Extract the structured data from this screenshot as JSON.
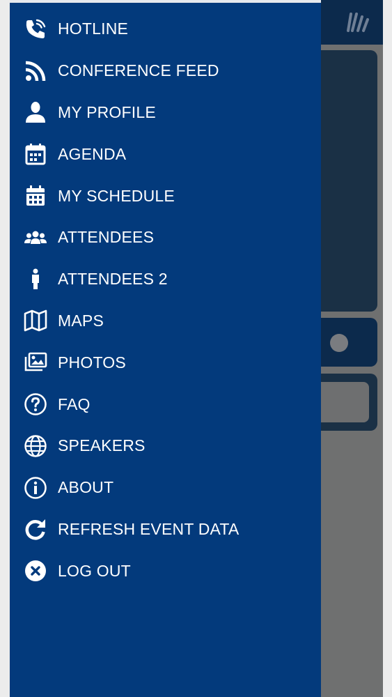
{
  "colors": {
    "drawer_bg": "#033a7c",
    "overlay_bg": "#6f7070",
    "app_header_bg": "#0c2a4c",
    "text": "#ffffff"
  },
  "menu": {
    "items": [
      {
        "label": "HOTLINE",
        "icon": "phone-icon"
      },
      {
        "label": "CONFERENCE FEED",
        "icon": "rss-icon"
      },
      {
        "label": "MY PROFILE",
        "icon": "user-icon"
      },
      {
        "label": "AGENDA",
        "icon": "calendar-icon"
      },
      {
        "label": "MY SCHEDULE",
        "icon": "calendar-filled-icon"
      },
      {
        "label": "ATTENDEES",
        "icon": "users-icon"
      },
      {
        "label": "ATTENDEES 2",
        "icon": "person-icon"
      },
      {
        "label": "MAPS",
        "icon": "map-icon"
      },
      {
        "label": "PHOTOS",
        "icon": "images-icon"
      },
      {
        "label": "FAQ",
        "icon": "question-circle-icon"
      },
      {
        "label": "SPEAKERS",
        "icon": "globe-icon"
      },
      {
        "label": "ABOUT",
        "icon": "info-circle-icon"
      },
      {
        "label": "REFRESH EVENT DATA",
        "icon": "refresh-icon"
      },
      {
        "label": "LOG OUT",
        "icon": "close-circle-icon"
      }
    ]
  }
}
